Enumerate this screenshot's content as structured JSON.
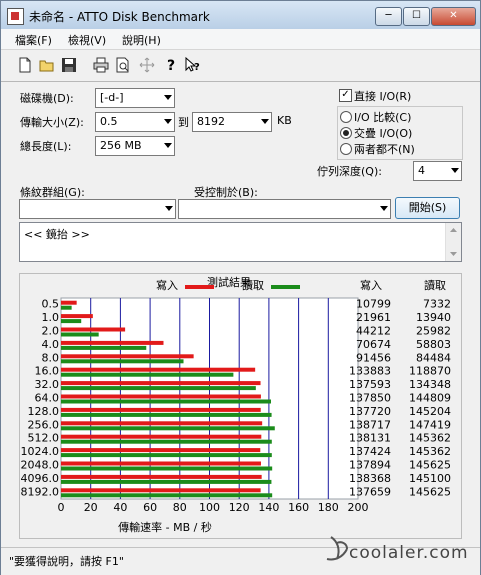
{
  "window": {
    "title": "未命名 - ATTO Disk Benchmark",
    "minimize": "─",
    "maximize": "☐",
    "close": "✕"
  },
  "menu": [
    "檔案(F)",
    "檢視(V)",
    "說明(H)"
  ],
  "toolbar": [
    "new-icon",
    "open-icon",
    "save-icon",
    "print-icon",
    "print-preview-icon",
    "move-icon",
    "help-icon",
    "context-help-icon"
  ],
  "settings": {
    "drive_label": "磁碟機(D):",
    "drive_value": "[-d-]",
    "transfer_label": "傳輸大小(Z):",
    "transfer_from": "0.5",
    "transfer_to_label": "到",
    "transfer_to": "8192",
    "transfer_unit": "KB",
    "length_label": "總長度(L):",
    "length_value": "256 MB",
    "direct_io_label": "直接 I/O(R)",
    "direct_io_checked": true,
    "io_compare": "I/O 比較(C)",
    "overlap_io": "交疊 I/O(O)",
    "neither": "兩者都不(N)",
    "queue_label": "佇列深度(Q):",
    "queue_value": "4",
    "pattern_label": "條紋群組(G):",
    "control_label": "受控制於(B):",
    "start_button": "開始(S)",
    "description": "<< 鏡抬 >>"
  },
  "results": {
    "title": "測試結果",
    "legend_write": "寫入",
    "legend_read": "讀取",
    "col_write": "寫入",
    "col_read": "讀取",
    "xlabel": "傳輸速率 - MB / 秒",
    "write_color": "#e21a1a",
    "read_color": "#1b8c1b"
  },
  "chart_data": {
    "type": "bar",
    "categories": [
      "0.5",
      "1.0",
      "2.0",
      "4.0",
      "8.0",
      "16.0",
      "32.0",
      "64.0",
      "128.0",
      "256.0",
      "512.0",
      "1024.0",
      "2048.0",
      "4096.0",
      "8192.0"
    ],
    "series": [
      {
        "name": "寫入",
        "values": [
          10799,
          21961,
          44212,
          70674,
          91456,
          133883,
          137593,
          137850,
          137720,
          138717,
          138131,
          137424,
          137894,
          138368,
          137659
        ]
      },
      {
        "name": "讀取",
        "values": [
          7332,
          13940,
          25982,
          58803,
          84484,
          118870,
          134348,
          144809,
          145204,
          147419,
          145362,
          145362,
          145625,
          145100,
          145625
        ]
      }
    ],
    "x_ticks": [
      "0",
      "20",
      "40",
      "60",
      "80",
      "100",
      "120",
      "140",
      "160",
      "180",
      "200"
    ],
    "xlim": [
      0,
      200
    ],
    "xlabel": "傳輸速率 - MB / 秒",
    "ylabel": ""
  },
  "status": {
    "text": "\"要獲得說明，請按 F1\""
  },
  "watermark": {
    "text": "coolaler.com"
  }
}
